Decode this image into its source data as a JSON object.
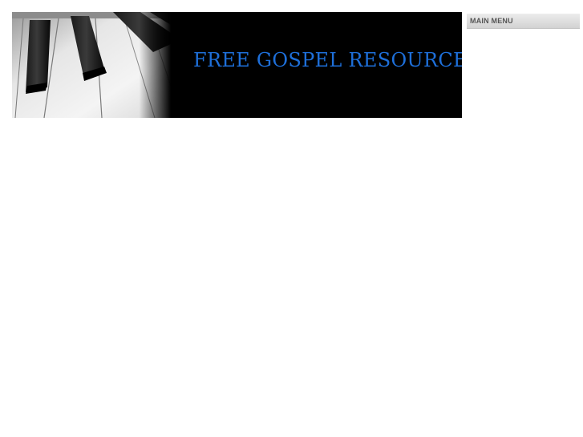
{
  "header": {
    "title": "FREE GOSPEL RESOURCE",
    "image": "piano-keys-image",
    "title_color": "#1e6fd9",
    "background_color": "#000000"
  },
  "sidebar": {
    "menu_title": "MAIN MENU"
  }
}
